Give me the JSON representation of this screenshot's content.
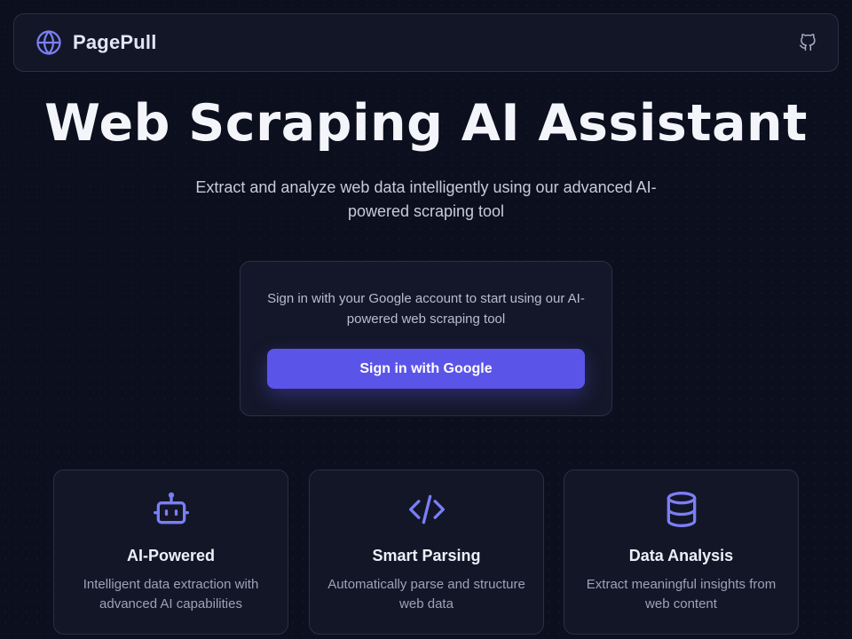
{
  "nav": {
    "brand": "PagePull",
    "brand_icon": "globe-icon",
    "github_icon": "github-icon"
  },
  "hero": {
    "title": "Web Scraping AI Assistant",
    "subtitle": "Extract and analyze web data intelligently using our advanced AI-powered scraping tool"
  },
  "signin": {
    "text": "Sign in with your Google account to start using our AI-powered web scraping tool",
    "button_label": "Sign in with Google"
  },
  "features": [
    {
      "icon": "robot-icon",
      "title": "AI-Powered",
      "description": "Intelligent data extraction with advanced AI capabilities"
    },
    {
      "icon": "code-icon",
      "title": "Smart Parsing",
      "description": "Automatically parse and structure web data"
    },
    {
      "icon": "database-icon",
      "title": "Data Analysis",
      "description": "Extract meaningful insights from web content"
    }
  ],
  "colors": {
    "background": "#0c0f1d",
    "card": "#141729",
    "accent": "#5b54e8",
    "icon": "#7b7ff5"
  }
}
